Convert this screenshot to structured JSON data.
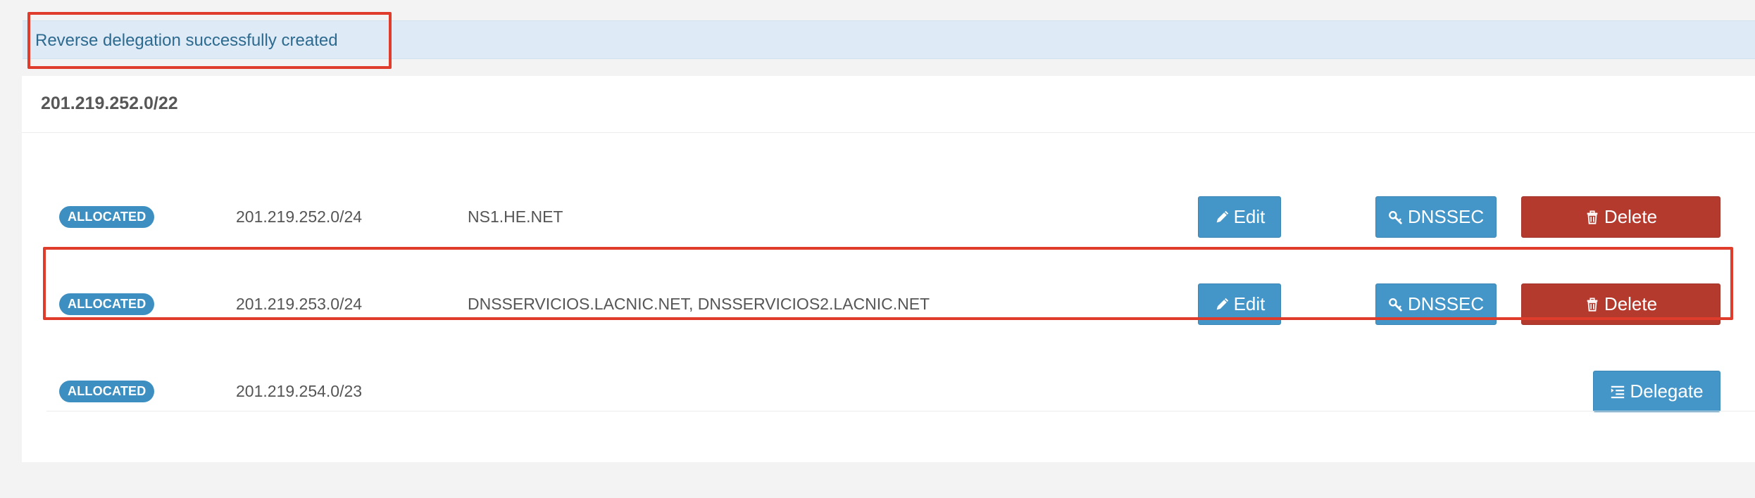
{
  "alert": {
    "message": "Reverse delegation successfully created"
  },
  "panel": {
    "title": "201.219.252.0/22"
  },
  "rows": [
    {
      "status": "ALLOCATED",
      "prefix": "201.219.252.0/24",
      "nameservers": "NS1.HE.NET",
      "edit_label": "Edit",
      "dnssec_label": "DNSSEC",
      "delete_label": "Delete"
    },
    {
      "status": "ALLOCATED",
      "prefix": "201.219.253.0/24",
      "nameservers": "DNSSERVICIOS.LACNIC.NET, DNSSERVICIOS2.LACNIC.NET",
      "edit_label": "Edit",
      "dnssec_label": "DNSSEC",
      "delete_label": "Delete"
    },
    {
      "status": "ALLOCATED",
      "prefix": "201.219.254.0/23",
      "nameservers": "",
      "delegate_label": "Delegate"
    }
  ],
  "icons": {
    "edit": "pencil-icon",
    "dnssec": "key-icon",
    "delete": "trash-icon",
    "delegate": "indent-list-icon"
  },
  "colors": {
    "alert_background": "#deebf7",
    "alert_text": "#2d6a8f",
    "badge": "#3e8fc1",
    "primary_button": "#4596c8",
    "danger_button": "#b53a2e",
    "highlight_outline": "#e03c2b"
  }
}
